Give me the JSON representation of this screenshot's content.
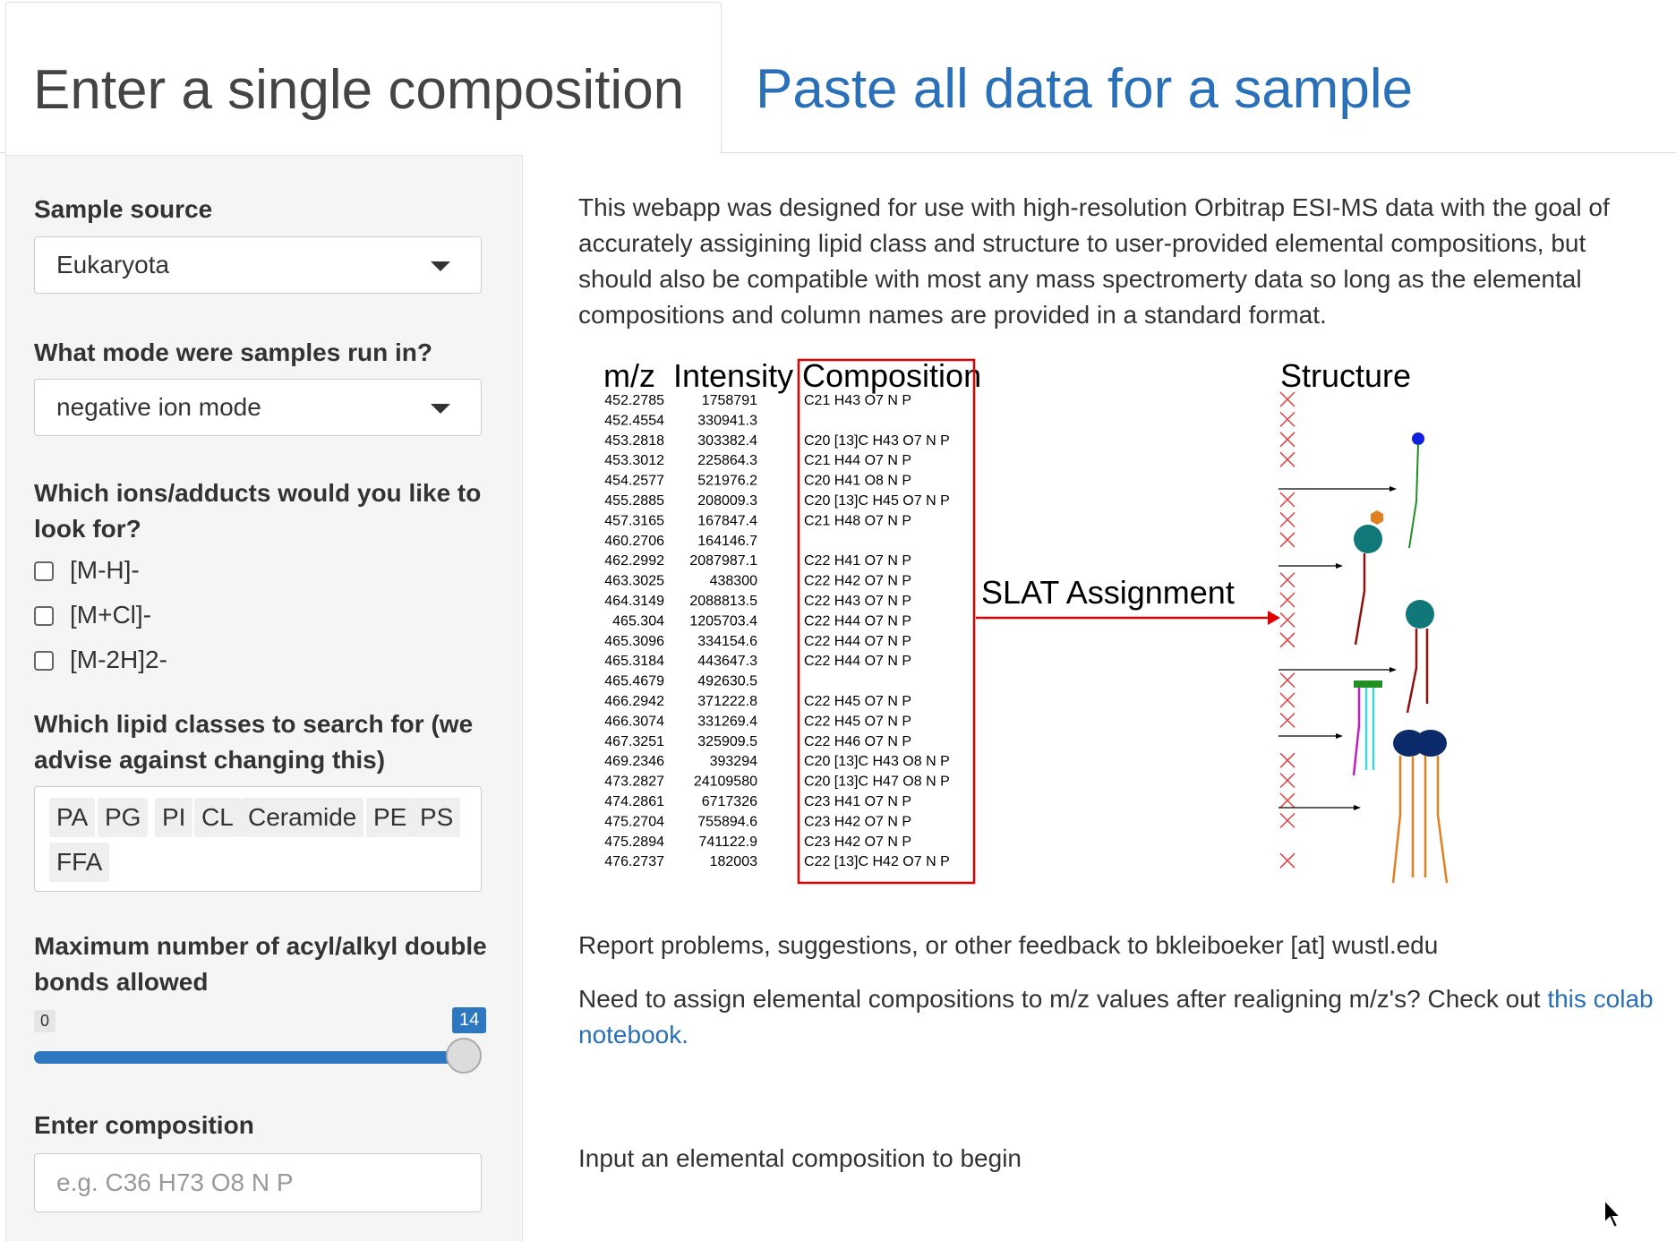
{
  "tabs": {
    "active": "Enter a single composition",
    "inactive": "Paste all data for a sample"
  },
  "sidebar": {
    "sample_source": {
      "label": "Sample source",
      "value": "Eukaryota"
    },
    "mode": {
      "label": "What mode were samples run in?",
      "value": "negative ion mode"
    },
    "adducts": {
      "label": "Which ions/adducts would you like to look for?",
      "options": [
        "[M-H]-",
        "[M+Cl]-",
        "[M-2H]2-"
      ]
    },
    "lipid_classes": {
      "label": "Which lipid classes to search for (we advise against changing this)",
      "chips": [
        "PA",
        "PG",
        "PI",
        "CL",
        "Ceramide",
        "PE",
        "PS",
        "FFA"
      ]
    },
    "double_bonds": {
      "label": "Maximum number of acyl/alkyl double bonds allowed",
      "min": "0",
      "max": "14",
      "value_fraction": 1.0
    },
    "composition": {
      "label": "Enter composition",
      "placeholder": "e.g. C36 H73 O8 N P"
    }
  },
  "main": {
    "intro": "This webapp was designed for use with high-resolution Orbitrap ESI-MS data with the goal of accurately assigining lipid class and structure to user-provided elemental compositions, but should also be compatible with most any mass spectromerty data so long as the elemental compositions and column names are provided in a standard format.",
    "report": "Report problems, suggestions, or other feedback to bkleiboeker [at] wustl.edu",
    "colab_prefix": "Need to assign elemental compositions to m/z values after realigning m/z's? Check out ",
    "colab_link": "this colab notebook.",
    "begin": "Input an elemental composition to begin"
  },
  "figure": {
    "headers": {
      "mz": "m/z",
      "intensity": "Intensity",
      "composition": "Composition",
      "structure": "Structure"
    },
    "arrow_label": "SLAT Assignment",
    "rows": [
      [
        "452.2785",
        "1758791",
        "C21 H43 O7 N P"
      ],
      [
        "452.4554",
        "330941.3",
        ""
      ],
      [
        "453.2818",
        "303382.4",
        "C20 [13]C H43 O7 N P"
      ],
      [
        "453.3012",
        "225864.3",
        "C21 H44 O7 N P"
      ],
      [
        "454.2577",
        "521976.2",
        "C20 H41 O8 N P"
      ],
      [
        "455.2885",
        "208009.3",
        "C20 [13]C H45 O7 N P"
      ],
      [
        "457.3165",
        "167847.4",
        "C21 H48 O7 N P"
      ],
      [
        "460.2706",
        "164146.7",
        ""
      ],
      [
        "462.2992",
        "2087987.1",
        "C22 H41 O7 N P"
      ],
      [
        "463.3025",
        "438300",
        "C22 H42 O7 N P"
      ],
      [
        "464.3149",
        "2088813.5",
        "C22 H43 O7 N P"
      ],
      [
        "465.304",
        "1205703.4",
        "C22 H44 O7 N P"
      ],
      [
        "465.3096",
        "334154.6",
        "C22 H44 O7 N P"
      ],
      [
        "465.3184",
        "443647.3",
        "C22 H44 O7 N P"
      ],
      [
        "465.4679",
        "492630.5",
        ""
      ],
      [
        "466.2942",
        "371222.8",
        "C22 H45 O7 N P"
      ],
      [
        "466.3074",
        "331269.4",
        "C22 H45 O7 N P"
      ],
      [
        "467.3251",
        "325909.5",
        "C22 H46 O7 N P"
      ],
      [
        "469.2346",
        "393294",
        "C20 [13]C H43 O8 N P"
      ],
      [
        "473.2827",
        "24109580",
        "C20 [13]C H47 O8 N P"
      ],
      [
        "474.2861",
        "6717326",
        "C23 H41 O7 N P"
      ],
      [
        "475.2704",
        "755894.6",
        "C23 H42 O7 N P"
      ],
      [
        "475.2894",
        "741122.9",
        "C23 H42 O7 N P"
      ],
      [
        "476.2737",
        "182003",
        "C22 [13]C H42 O7 N P"
      ]
    ],
    "structure_marks": [
      "x",
      "x",
      "x",
      "x",
      "",
      "x",
      "x",
      "x",
      "",
      "x",
      "x",
      "x",
      "x",
      "",
      "x",
      "x",
      "x",
      "",
      "x",
      "x",
      "x",
      "x",
      "",
      "x"
    ],
    "colors": {
      "box": "#e00000",
      "arrow": "#e00000",
      "x_mark": "#e04040",
      "blue": "#1020e0",
      "teal": "#107878",
      "orange": "#e08020",
      "green": "#209020",
      "darkred": "#901010",
      "magenta": "#c020c0",
      "cyan": "#40d8d8",
      "navy": "#0a2a6a"
    }
  }
}
